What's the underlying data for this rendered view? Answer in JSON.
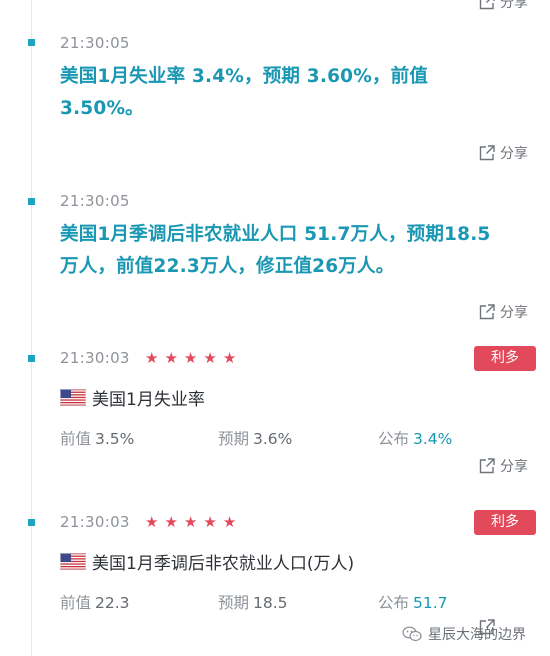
{
  "share_label": "分享",
  "items": [
    {
      "time": "21:30:05",
      "line1": "美国1月失业率 3.4%，预期 3.60%，前值",
      "line2": "3.50%。"
    },
    {
      "time": "21:30:05",
      "line1": "美国1月季调后非农就业人口 51.7万人，预期18.5",
      "line2": "万人，前值22.3万人，修正值26万人。"
    },
    {
      "time": "21:30:03",
      "stars": 5,
      "badge": "利多",
      "indicator": "美国1月失业率",
      "prev_label": "前值",
      "prev_value": "3.5%",
      "exp_label": "预期",
      "exp_value": "3.6%",
      "pub_label": "公布",
      "pub_value": "3.4%"
    },
    {
      "time": "21:30:03",
      "stars": 5,
      "badge": "利多",
      "indicator": "美国1月季调后非农就业人口(万人)",
      "prev_label": "前值",
      "prev_value": "22.3",
      "exp_label": "预期",
      "exp_value": "18.5",
      "pub_label": "公布",
      "pub_value": "51.7"
    }
  ],
  "watermark": "星辰大海的边界",
  "colors": {
    "accent": "#1a98b3",
    "badge": "#e2495a",
    "star": "#e24a5c"
  }
}
